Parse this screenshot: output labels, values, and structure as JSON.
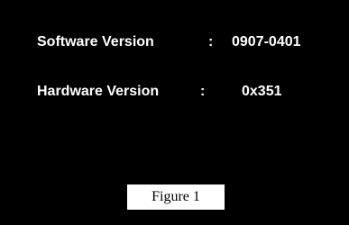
{
  "version_info": {
    "software": {
      "label": "Software Version",
      "separator": ":",
      "value": "0907-0401"
    },
    "hardware": {
      "label": "Hardware Version",
      "separator": ":",
      "value": "0x351"
    }
  },
  "caption": "Figure 1",
  "colors": {
    "screen_background": "#000000",
    "text": "#ffffff",
    "caption_background": "#ffffff",
    "caption_text": "#000000"
  }
}
